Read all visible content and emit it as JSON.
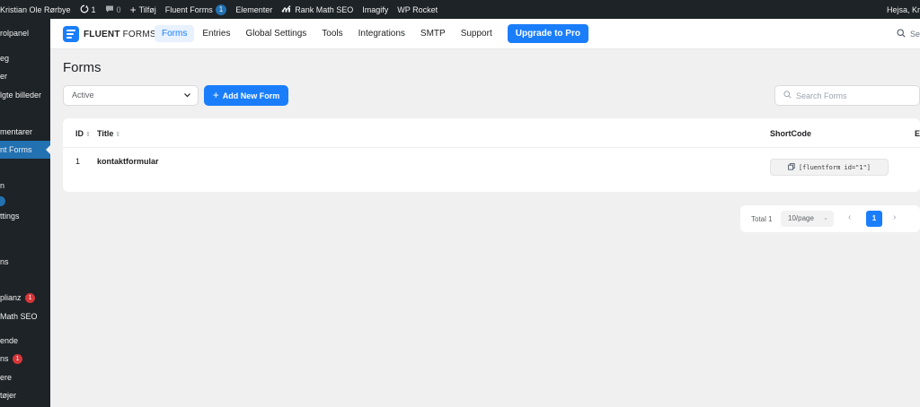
{
  "admin_bar": {
    "site_name": "Kristian Ole Rørbye",
    "updates_count": "1",
    "comments_count": "0",
    "new_label": "Tilføj",
    "fluent_forms_label": "Fluent Forms",
    "fluent_forms_badge": "1",
    "elementor_label": "Elementer",
    "rank_math_label": "Rank Math SEO",
    "imagify_label": "Imagify",
    "wp_rocket_label": "WP Rocket",
    "greeting": "Hejsa, Kr"
  },
  "sidebar": {
    "items": [
      {
        "label": "rolpanel"
      },
      {
        "label": "eg"
      },
      {
        "label": "er"
      },
      {
        "label": "lgte billeder"
      },
      {
        "label": "mentarer"
      },
      {
        "label": "nt Forms"
      },
      {
        "label": "n"
      },
      {
        "label": "ttings"
      },
      {
        "label": "ns"
      },
      {
        "label": "plianz",
        "badge": "1"
      },
      {
        "label": "Math SEO"
      },
      {
        "label": "ende"
      },
      {
        "label": "ns",
        "badge": "1"
      },
      {
        "label": "ere"
      },
      {
        "label": "tøjer"
      }
    ]
  },
  "ff_header": {
    "logo_bold": "FLUENT",
    "logo_light": "FORMS",
    "nav": [
      "Forms",
      "Entries",
      "Global Settings",
      "Tools",
      "Integrations",
      "SMTP",
      "Support"
    ],
    "upgrade_label": "Upgrade to Pro",
    "search_label": "Se"
  },
  "main": {
    "title": "Forms",
    "status_filter": "Active",
    "add_button": "Add New Form",
    "search_placeholder": "Search Forms"
  },
  "table": {
    "headers": {
      "id": "ID",
      "title": "Title",
      "shortcode": "ShortCode",
      "entries": "E"
    },
    "rows": [
      {
        "id": "1",
        "title": "kontaktformular",
        "shortcode": "[fluentform id=\"1\"]"
      }
    ]
  },
  "pagination": {
    "total": "Total 1",
    "page_size": "10/page",
    "current_page": "1"
  },
  "colors": {
    "primary": "#1a7efb",
    "wp_dark": "#1d2327",
    "wp_blue": "#2271b1",
    "badge_red": "#d63638"
  },
  "icons": [
    "updates-icon",
    "comments-icon",
    "plus-icon",
    "rank-math-icon",
    "search-icon",
    "copy-icon",
    "chevron-down-icon",
    "chevron-left-icon",
    "chevron-right-icon",
    "sort-icon"
  ]
}
